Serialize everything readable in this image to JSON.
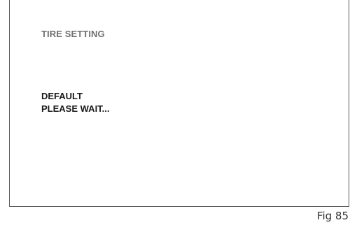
{
  "screen": {
    "title": "TIRE SETTING",
    "message_line1": "DEFAULT",
    "message_line2": "PLEASE WAIT..."
  },
  "figure": {
    "label": "Fig 85"
  }
}
